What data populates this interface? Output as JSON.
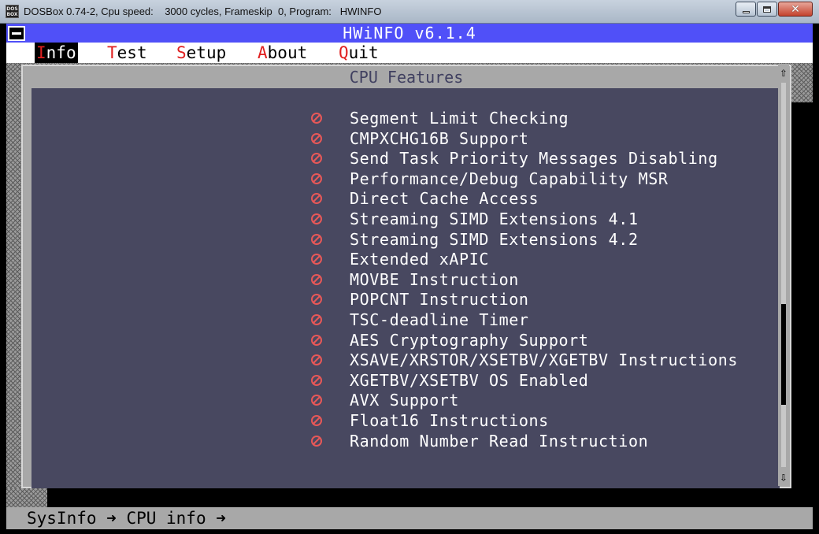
{
  "window": {
    "icon_text": "DOS BOX",
    "title": "DOSBox 0.74-2, Cpu speed:    3000 cycles, Frameskip  0, Program:   HWINFO"
  },
  "app": {
    "title": "HWiNFO v6.1.4"
  },
  "menu": [
    {
      "label": "Info",
      "hotkey": "I",
      "rest": "nfo",
      "active": true
    },
    {
      "label": "Test",
      "hotkey": "T",
      "rest": "est",
      "active": false
    },
    {
      "label": "Setup",
      "hotkey": "S",
      "rest": "etup",
      "active": false
    },
    {
      "label": "About",
      "hotkey": "A",
      "rest": "bout",
      "active": false
    },
    {
      "label": "Quit",
      "hotkey": "Q",
      "rest": "uit",
      "active": false
    }
  ],
  "dialog": {
    "title": "CPU Features",
    "features": [
      {
        "name": "Segment Limit Checking",
        "supported": false
      },
      {
        "name": "CMPXCHG16B Support",
        "supported": false
      },
      {
        "name": "Send Task Priority Messages Disabling",
        "supported": false
      },
      {
        "name": "Performance/Debug Capability MSR",
        "supported": false
      },
      {
        "name": "Direct Cache Access",
        "supported": false
      },
      {
        "name": "Streaming SIMD Extensions 4.1",
        "supported": false
      },
      {
        "name": "Streaming SIMD Extensions 4.2",
        "supported": false
      },
      {
        "name": "Extended xAPIC",
        "supported": false
      },
      {
        "name": "MOVBE Instruction",
        "supported": false
      },
      {
        "name": "POPCNT Instruction",
        "supported": false
      },
      {
        "name": "TSC-deadline Timer",
        "supported": false
      },
      {
        "name": "AES Cryptography Support",
        "supported": false
      },
      {
        "name": "XSAVE/XRSTOR/XSETBV/XGETBV Instructions",
        "supported": false
      },
      {
        "name": "XGETBV/XSETBV OS Enabled",
        "supported": false
      },
      {
        "name": "AVX Support",
        "supported": false
      },
      {
        "name": "Float16 Instructions",
        "supported": false
      },
      {
        "name": "Random Number Read Instruction",
        "supported": false
      }
    ],
    "scroll_position": 0.78
  },
  "status": {
    "breadcrumb": [
      "SysInfo",
      "CPU info"
    ],
    "separator": "➜"
  },
  "colors": {
    "header_bg": "#5050f8",
    "dialog_body_bg": "#484860",
    "unsupported_icon": "#e85858",
    "hotkey": "#e02020"
  }
}
